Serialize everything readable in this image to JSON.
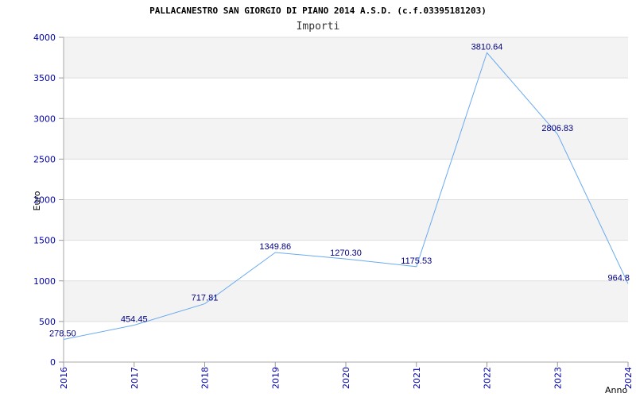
{
  "chart_data": {
    "type": "line",
    "title": "PALLACANESTRO SAN GIORGIO DI PIANO 2014 A.S.D. (c.f.03395181203)",
    "subtitle": "Importi",
    "xlabel": "Anno",
    "ylabel": "Euro",
    "categories": [
      "2016",
      "2017",
      "2018",
      "2019",
      "2020",
      "2021",
      "2022",
      "2023",
      "2024"
    ],
    "series": [
      {
        "values": [
          278.5,
          454.45,
          717.81,
          1349.86,
          1270.3,
          1175.53,
          3810.64,
          2806.83,
          964.8
        ],
        "labels": [
          "278.50",
          "454.45",
          "717.81",
          "1349.86",
          "1270.30",
          "1175.53",
          "3810.64",
          "2806.83",
          "964.8"
        ]
      }
    ],
    "ylim": [
      0,
      4000
    ],
    "yticks": [
      0,
      500,
      1000,
      1500,
      2000,
      2500,
      3000,
      3500,
      4000
    ],
    "grid": true,
    "legend": "none",
    "colors": {
      "line": "#6aaaf0",
      "band": "#f3f3f3",
      "grid": "#dddddd",
      "tick": "#0000aa",
      "label": "#000080"
    }
  }
}
